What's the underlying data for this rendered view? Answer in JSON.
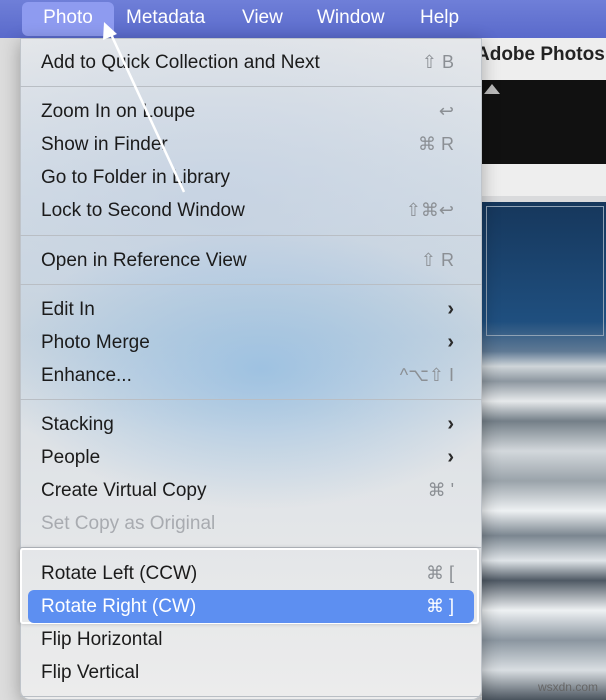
{
  "menubar": {
    "items": [
      "Photo",
      "Metadata",
      "View",
      "Window",
      "Help"
    ]
  },
  "background_app": {
    "title": "Adobe Photos",
    "watermark": "wsxdn.com"
  },
  "menu": {
    "add_quick": {
      "label": "Add to Quick Collection and Next",
      "shortcut": "⇧ B"
    },
    "zoom_in": {
      "label": "Zoom In on Loupe",
      "shortcut": "↩"
    },
    "show_finder": {
      "label": "Show in Finder",
      "shortcut": "⌘ R"
    },
    "goto_folder": {
      "label": "Go to Folder in Library",
      "shortcut": ""
    },
    "lock_second": {
      "label": "Lock to Second Window",
      "shortcut": "⇧⌘↩"
    },
    "open_reference": {
      "label": "Open in Reference View",
      "shortcut": "⇧ R"
    },
    "edit_in": {
      "label": "Edit In",
      "arrow": "›"
    },
    "photo_merge": {
      "label": "Photo Merge",
      "arrow": "›"
    },
    "enhance": {
      "label": "Enhance...",
      "shortcut": "^⌥⇧ I"
    },
    "stacking": {
      "label": "Stacking",
      "arrow": "›"
    },
    "people": {
      "label": "People",
      "arrow": "›"
    },
    "create_virtual": {
      "label": "Create Virtual Copy",
      "shortcut": "⌘ '"
    },
    "set_copy_original": {
      "label": "Set Copy as Original",
      "shortcut": ""
    },
    "rotate_left": {
      "label": "Rotate Left (CCW)",
      "shortcut": "⌘ ["
    },
    "rotate_right": {
      "label": "Rotate Right (CW)",
      "shortcut": "⌘ ]"
    },
    "flip_horizontal": {
      "label": "Flip Horizontal",
      "shortcut": ""
    },
    "flip_vertical": {
      "label": "Flip Vertical",
      "shortcut": ""
    }
  },
  "colors": {
    "menubar": "#5a6acb",
    "selected_row": "#5d8ff1"
  }
}
